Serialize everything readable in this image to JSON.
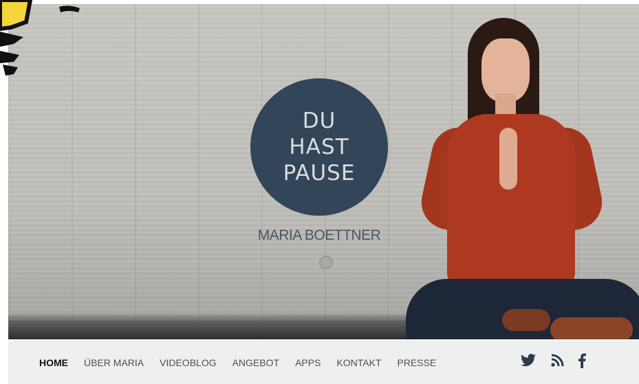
{
  "hero": {
    "logo_lines": [
      "DU",
      "HAST",
      "PAUSE"
    ],
    "brand_name": "MARIA BOETTNER"
  },
  "nav": {
    "items": [
      {
        "label": "HOME",
        "active": true
      },
      {
        "label": "ÜBER MARIA",
        "active": false
      },
      {
        "label": "VIDEOBLOG",
        "active": false
      },
      {
        "label": "ANGEBOT",
        "active": false
      },
      {
        "label": "APPS",
        "active": false
      },
      {
        "label": "KONTAKT",
        "active": false
      },
      {
        "label": "PRESSE",
        "active": false
      }
    ],
    "social": [
      "twitter-icon",
      "rss-icon",
      "facebook-icon"
    ]
  },
  "colors": {
    "logo_circle": "#334558",
    "nav_background": "#eef0f0",
    "nav_text": "#4a4e56",
    "social_icons": "#2b3a4d"
  }
}
